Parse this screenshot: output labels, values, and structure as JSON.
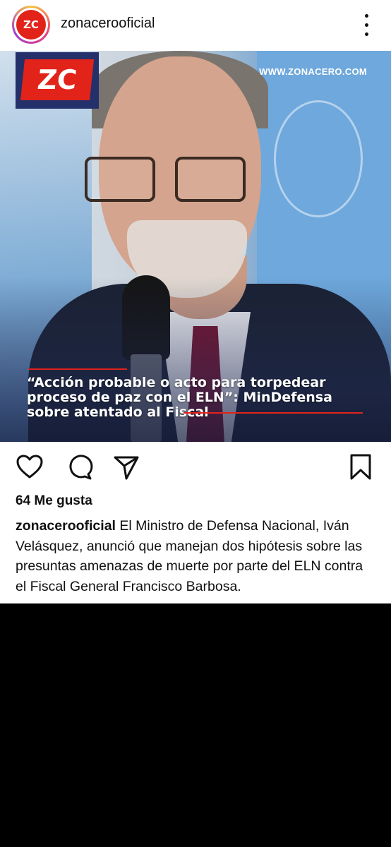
{
  "post": {
    "username": "zonacerooficial",
    "avatar_text": "ZC",
    "image": {
      "logo_text": "ZC",
      "site_url": "WWW.ZONACERO.COM",
      "headline": "“Acción probable o acto para torpedear proceso de paz con el ELN”: MinDefensa sobre atentado al Fiscal"
    },
    "likes": "64 Me gusta",
    "caption_user": "zonacerooficial",
    "caption_text": " El Ministro de Defensa Nacional, Iván Velásquez, anunció que manejan dos hipótesis sobre las presuntas amenazas de muerte por parte del ELN contra el Fiscal General Francisco Barbosa."
  },
  "icons": {
    "more": "more-vertical-icon",
    "like": "heart-icon",
    "comment": "comment-icon",
    "share": "send-icon",
    "save": "bookmark-icon"
  },
  "colors": {
    "brand_red": "#e2231a",
    "brand_navy": "#23306a"
  }
}
